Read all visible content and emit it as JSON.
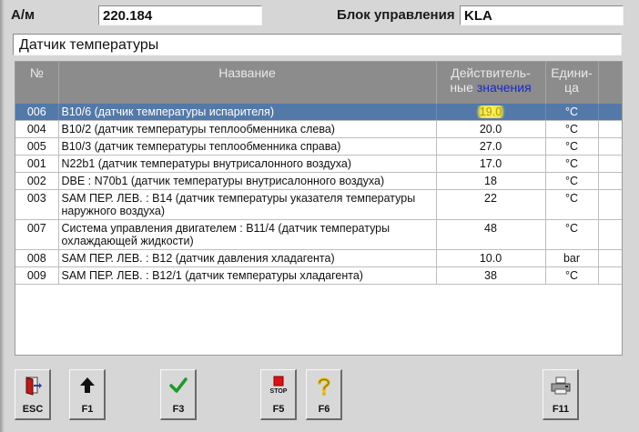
{
  "header": {
    "model_label": "А/м",
    "model_value": "220.184",
    "control_unit_label": "Блок управления",
    "control_unit_value": "KLA"
  },
  "screen_title": "Датчик температуры",
  "table": {
    "columns": {
      "num": "№",
      "name": "Название",
      "value_line1": "Действитель-",
      "value_line2a": "ные ",
      "value_line2b": "значения",
      "unit_line1": "Едини-",
      "unit_line2": "ца"
    },
    "rows": [
      {
        "num": "006",
        "name": "B10/6 (датчик температуры испарителя)",
        "value": "19.0",
        "unit": "°C",
        "selected": true
      },
      {
        "num": "004",
        "name": "B10/2 (датчик температуры теплообменника слева)",
        "value": "20.0",
        "unit": "°C"
      },
      {
        "num": "005",
        "name": "B10/3 (датчик температуры теплообменника справа)",
        "value": "27.0",
        "unit": "°C"
      },
      {
        "num": "001",
        "name": "N22b1 (датчик температуры внутрисалонного воздуха)",
        "value": "17.0",
        "unit": "°C"
      },
      {
        "num": "002",
        "name": "DBE : N70b1 (датчик температуры внутрисалонного воздуха)",
        "value": "18",
        "unit": "°C"
      },
      {
        "num": "003",
        "name": "SAM ПЕР. ЛЕВ. : B14 (датчик температуры указателя температуры наружного воздуха)",
        "value": "22",
        "unit": "°C"
      },
      {
        "num": "007",
        "name": "Система управления двигателем : B11/4 (датчик температуры охлаждающей жидкости)",
        "value": "48",
        "unit": "°C"
      },
      {
        "num": "008",
        "name": "SAM ПЕР. ЛЕВ. : B12 (датчик давления хладагента)",
        "value": "10.0",
        "unit": "bar"
      },
      {
        "num": "009",
        "name": "SAM ПЕР. ЛЕВ. : B12/1 (датчик температуры хладагента)",
        "value": "38",
        "unit": "°C"
      }
    ]
  },
  "toolbar": {
    "esc": {
      "key": "ESC",
      "icon": "exit-door-icon"
    },
    "f1": {
      "key": "F1",
      "icon": "arrow-up-icon"
    },
    "f3": {
      "key": "F3",
      "icon": "checkmark-icon"
    },
    "f5": {
      "key": "F5",
      "icon": "stop-icon",
      "icon_text": "STOP"
    },
    "f6": {
      "key": "F6",
      "icon": "help-question-icon"
    },
    "f11": {
      "key": "F11",
      "icon": "printer-icon"
    }
  },
  "colors": {
    "background": "#d6d6d6",
    "header_row": "#8c8c8c",
    "selected_row": "#5379a8",
    "highlight": "#f0e048",
    "check_green": "#1e9a2a",
    "stop_red": "#e01010"
  }
}
